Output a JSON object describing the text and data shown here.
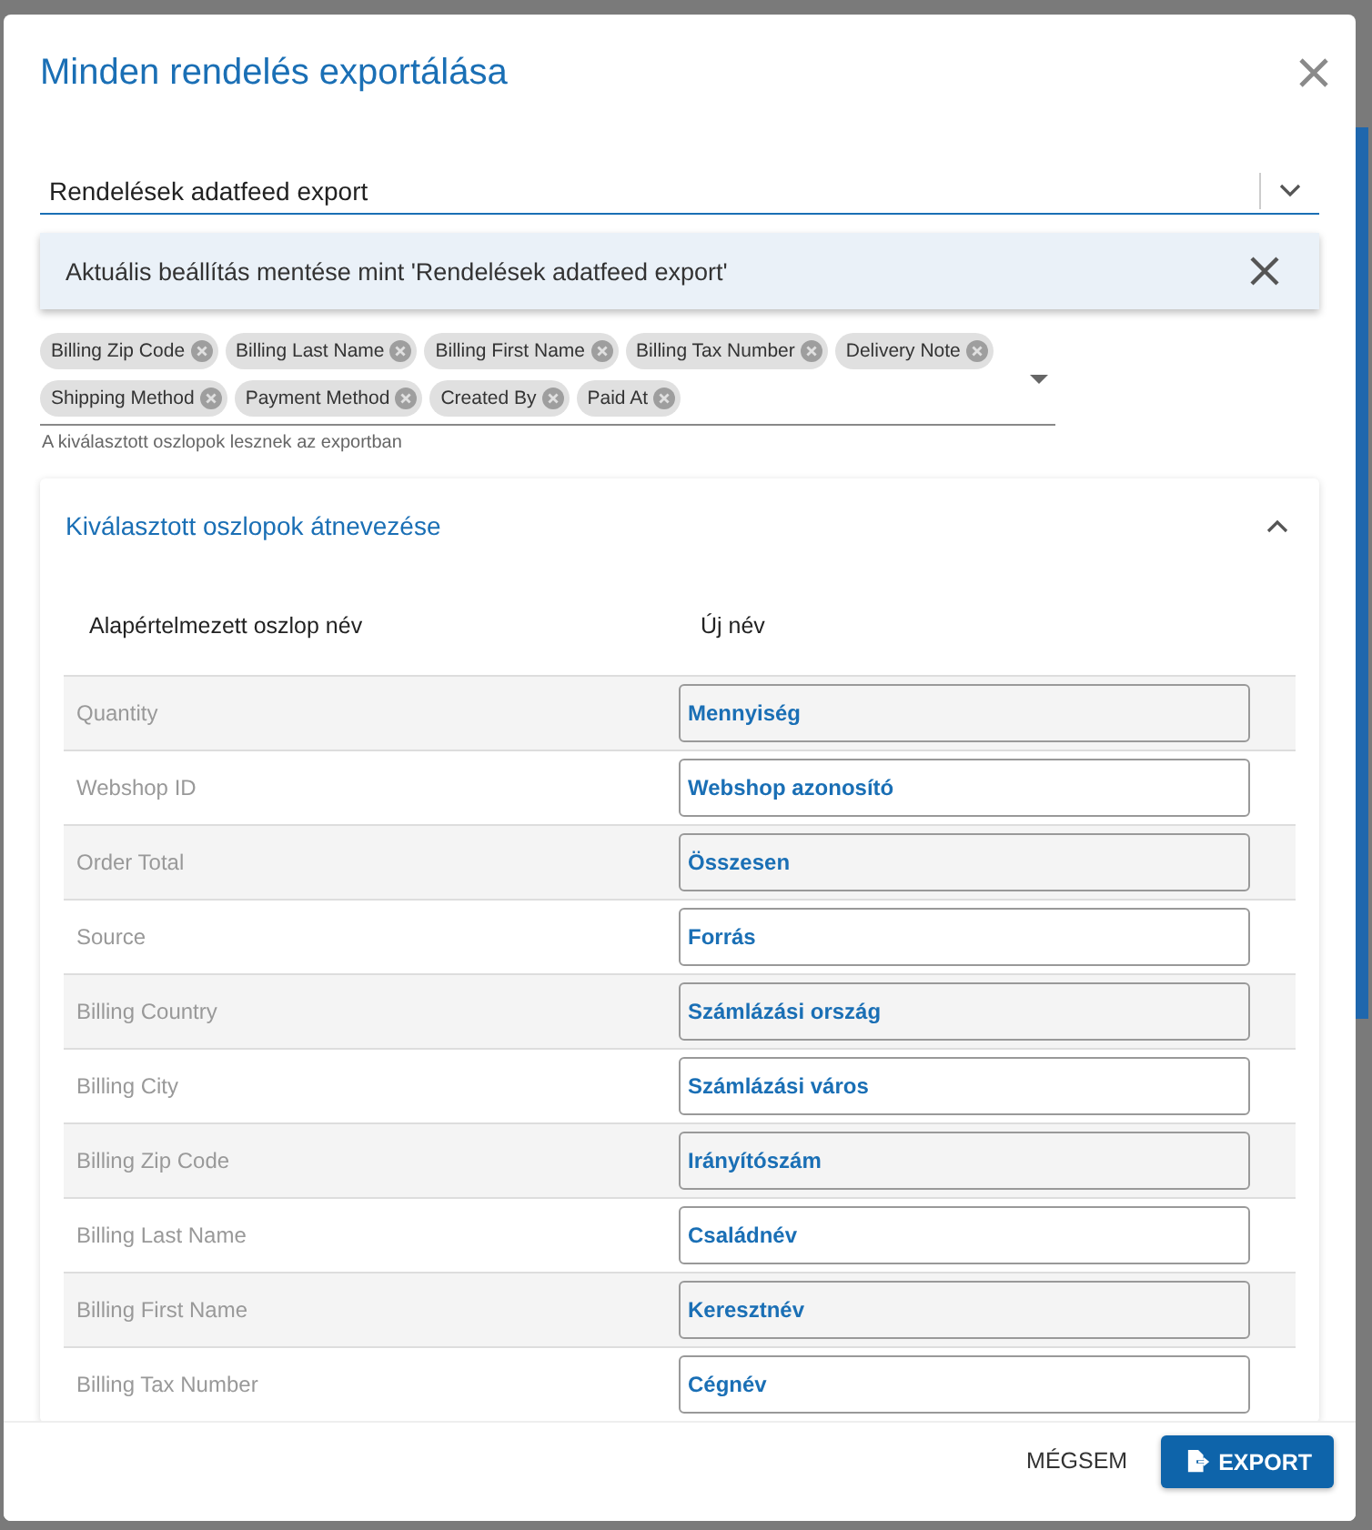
{
  "dialog": {
    "title": "Minden rendelés exportálása"
  },
  "preset": {
    "value": "Rendelések adatfeed export",
    "suggestion": "Aktuális beállítás mentése mint 'Rendelések adatfeed export'"
  },
  "columns_select": {
    "chips": [
      {
        "label": "Billing Zip Code"
      },
      {
        "label": "Billing Last Name"
      },
      {
        "label": "Billing First Name"
      },
      {
        "label": "Billing Tax Number"
      },
      {
        "label": "Delivery Note"
      },
      {
        "label": "Shipping Method"
      },
      {
        "label": "Payment Method"
      },
      {
        "label": "Created By"
      },
      {
        "label": "Paid At"
      }
    ],
    "helper": "A kiválasztott oszlopok lesznek az exportban"
  },
  "rename_panel": {
    "title": "Kiválasztott oszlopok átnevezése",
    "expanded": true,
    "headers": [
      "Alapértelmezett oszlop név",
      "Új név"
    ],
    "rows": [
      {
        "default": "Quantity",
        "new": "Mennyiség"
      },
      {
        "default": "Webshop ID",
        "new": "Webshop azonosító"
      },
      {
        "default": "Order Total",
        "new": "Összesen"
      },
      {
        "default": "Source",
        "new": "Forrás"
      },
      {
        "default": "Billing Country",
        "new": "Számlázási ország"
      },
      {
        "default": "Billing City",
        "new": "Számlázási város"
      },
      {
        "default": "Billing Zip Code",
        "new": "Irányítószám"
      },
      {
        "default": "Billing Last Name",
        "new": "Családnév"
      },
      {
        "default": "Billing First Name",
        "new": "Keresztnév"
      },
      {
        "default": "Billing Tax Number",
        "new": "Cégnév"
      }
    ]
  },
  "footer": {
    "cancel": "MÉGSEM",
    "export": "EXPORT"
  }
}
